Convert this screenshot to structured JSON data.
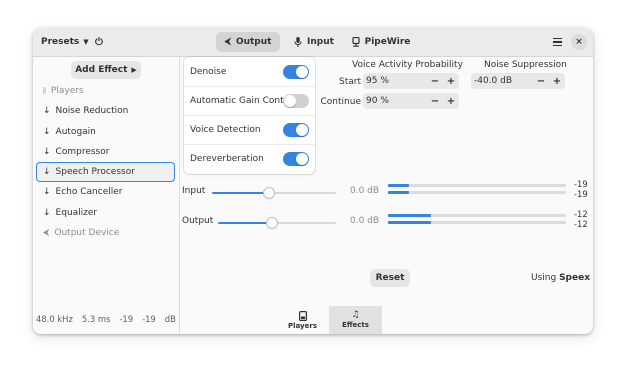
{
  "header": {
    "presets_label": "Presets",
    "tabs": [
      {
        "label": "Output",
        "icon": "output-arrow-icon",
        "active": true
      },
      {
        "label": "Input",
        "icon": "microphone-icon",
        "active": false
      },
      {
        "label": "PipeWire",
        "icon": "pipewire-icon",
        "active": false
      }
    ]
  },
  "sidebar": {
    "add_effect_label": "Add Effect",
    "items": [
      {
        "label": "Players",
        "icon": "players-icon",
        "dim": true
      },
      {
        "label": "Noise Reduction",
        "icon": "arrow-down-icon"
      },
      {
        "label": "Autogain",
        "icon": "arrow-down-icon"
      },
      {
        "label": "Compressor",
        "icon": "arrow-down-icon"
      },
      {
        "label": "Speech Processor",
        "icon": "arrow-down-icon",
        "selected": true
      },
      {
        "label": "Echo Canceller",
        "icon": "arrow-down-icon"
      },
      {
        "label": "Equalizer",
        "icon": "arrow-down-icon"
      },
      {
        "label": "Output Device",
        "icon": "output-device-icon",
        "dim": true
      }
    ],
    "status": {
      "sample_rate": "48.0 kHz",
      "latency": "5.3 ms",
      "level_left": "-19",
      "level_right": "-19",
      "unit": "dB"
    }
  },
  "toggles": [
    {
      "label": "Denoise",
      "on": true
    },
    {
      "label": "Automatic Gain Control",
      "on": false
    },
    {
      "label": "Voice Detection",
      "on": true
    },
    {
      "label": "Dereverberation",
      "on": true
    }
  ],
  "vad": {
    "title": "Voice Activity Probability",
    "start_label": "Start",
    "start_value": "95 %",
    "continue_label": "Continue",
    "continue_value": "90 %"
  },
  "noise_suppression": {
    "title": "Noise Suppression",
    "value": "-40.0 dB"
  },
  "gains": {
    "input": {
      "label": "Input",
      "value": "0.0 dB",
      "slider_fraction": 0.46,
      "meter_fractions": [
        0.12,
        0.12
      ],
      "meter_values": [
        "-19",
        "-19"
      ]
    },
    "output": {
      "label": "Output",
      "value": "0.0 dB",
      "slider_fraction": 0.46,
      "meter_fractions": [
        0.24,
        0.24
      ],
      "meter_values": [
        "-12",
        "-12"
      ]
    }
  },
  "reset_label": "Reset",
  "engine": {
    "prefix": "Using",
    "name": "Speex"
  },
  "bottom_tabs": [
    {
      "label": "Players",
      "icon": "players-tab-icon",
      "active": false
    },
    {
      "label": "Effects",
      "icon": "music-note-icon",
      "active": true
    }
  ],
  "colors": {
    "accent": "#3584e4"
  }
}
